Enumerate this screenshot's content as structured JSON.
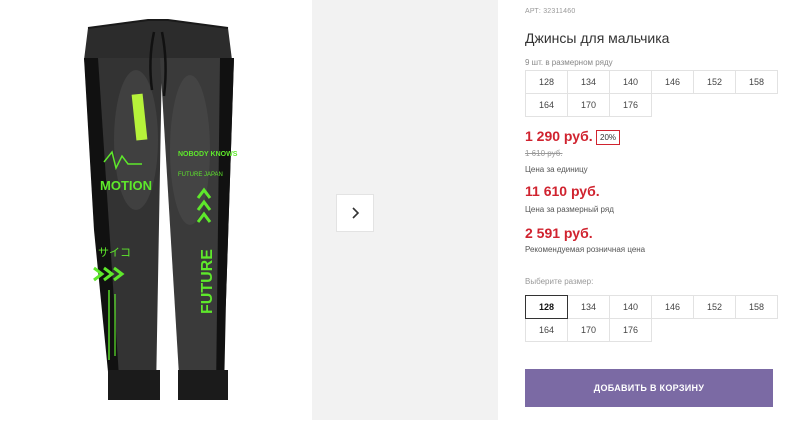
{
  "product": {
    "art": "АРТ: 32311460",
    "title": "Джинсы для мальчика",
    "pack_note": "9 шт. в размерном ряду",
    "pack_sizes": [
      "128",
      "134",
      "140",
      "146",
      "152",
      "158",
      "164",
      "170",
      "176"
    ],
    "image_prints": {
      "motion": "MOTION",
      "future": "FUTURE",
      "japanese": "サイコ",
      "label_top": "NOBODY KNOWS",
      "label_sub": "FUTURE JAPAN"
    }
  },
  "pricing": {
    "price": "1 290 руб.",
    "discount": "20%",
    "old_price": "1 610 руб.",
    "unit_label": "Цена за единицу",
    "pack_price": "11 610 руб.",
    "pack_label": "Цена за размерный ряд",
    "retail_price": "2 591 руб.",
    "retail_label": "Рекомендуемая розничная цена"
  },
  "size_picker": {
    "label": "Выберите размер:",
    "sizes": [
      "128",
      "134",
      "140",
      "146",
      "152",
      "158",
      "164",
      "170",
      "176"
    ],
    "selected": "128"
  },
  "cart": {
    "button_label": "ДОБАВИТЬ В КОРЗИНУ"
  },
  "colors": {
    "accent": "#d0232f",
    "button": "#7b6aa4",
    "neon": "#5ee82b"
  },
  "icons": {
    "next": "chevron-right-icon"
  }
}
